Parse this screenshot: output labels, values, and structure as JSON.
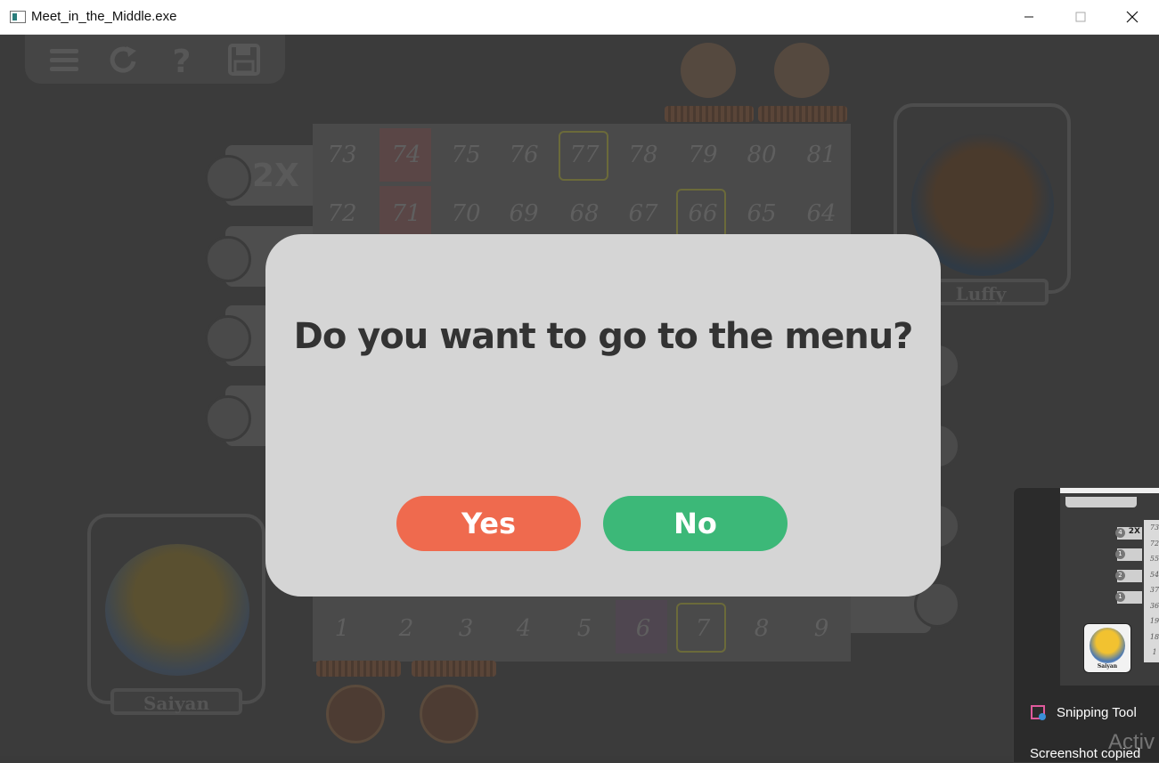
{
  "window": {
    "title": "Meet_in_the_Middle.exe",
    "app_icon": "app-window-icon",
    "controls": [
      "minimize-icon",
      "maximize-icon",
      "close-icon"
    ]
  },
  "toolbar": {
    "icons": [
      "menu-icon",
      "restart-icon",
      "help-icon",
      "save-icon"
    ]
  },
  "board": {
    "rows": [
      [
        "73",
        "74",
        "75",
        "76",
        "77",
        "78",
        "79",
        "80",
        "81"
      ],
      [
        "72",
        "71",
        "70",
        "69",
        "68",
        "67",
        "66",
        "65",
        "64"
      ],
      [
        "1",
        "2",
        "3",
        "4",
        "5",
        "6",
        "7",
        "8",
        "9"
      ]
    ]
  },
  "powerups": {
    "double_label": "2X"
  },
  "players": {
    "top": {
      "name": "Luffy"
    },
    "bottom": {
      "name": "Saiyan"
    }
  },
  "dialog": {
    "message": "Do you want to go to the menu?",
    "yes_label": "Yes",
    "no_label": "No",
    "yes_color": "#ef6a4e",
    "no_color": "#3cb878"
  },
  "notification": {
    "app_name": "Snipping Tool",
    "message": "Screenshot copied",
    "thumbnail": {
      "powerup_counts": [
        "4",
        "1",
        "2",
        "1"
      ],
      "double_label": "2X",
      "cells": [
        "73",
        "72",
        "55",
        "54",
        "37",
        "36",
        "19",
        "18",
        "1"
      ],
      "player_name": "Saiyan"
    }
  },
  "watermark": "Activ",
  "colors": {
    "overlay": "#3b3b3b",
    "dialog_bg": "#d5d5d5",
    "dialog_text": "#333333"
  }
}
